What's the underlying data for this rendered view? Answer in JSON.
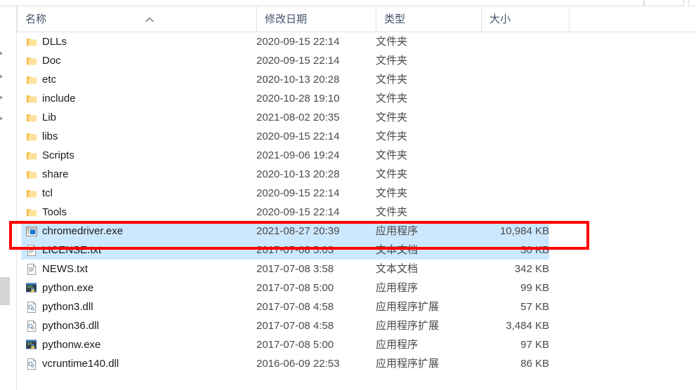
{
  "window": {
    "title": "File Explorer list view",
    "selection_color": "#cce8ff",
    "annotation_color": "#ff0000"
  },
  "columns": {
    "name": "名称",
    "date_modified": "修改日期",
    "type": "类型",
    "size": "大小",
    "sort_indicator": "ascending-caret"
  },
  "rows": [
    {
      "icon": "folder-icon",
      "name": "DLLs",
      "date": "2020-09-15 22:14",
      "type": "文件夹",
      "size": "",
      "selected": false
    },
    {
      "icon": "folder-icon",
      "name": "Doc",
      "date": "2020-09-15 22:14",
      "type": "文件夹",
      "size": "",
      "selected": false
    },
    {
      "icon": "folder-icon",
      "name": "etc",
      "date": "2020-10-13 20:28",
      "type": "文件夹",
      "size": "",
      "selected": false
    },
    {
      "icon": "folder-icon",
      "name": "include",
      "date": "2020-10-28 19:10",
      "type": "文件夹",
      "size": "",
      "selected": false
    },
    {
      "icon": "folder-icon",
      "name": "Lib",
      "date": "2021-08-02 20:35",
      "type": "文件夹",
      "size": "",
      "selected": false
    },
    {
      "icon": "folder-icon",
      "name": "libs",
      "date": "2020-09-15 22:14",
      "type": "文件夹",
      "size": "",
      "selected": false
    },
    {
      "icon": "folder-icon",
      "name": "Scripts",
      "date": "2021-09-06 19:24",
      "type": "文件夹",
      "size": "",
      "selected": false
    },
    {
      "icon": "folder-icon",
      "name": "share",
      "date": "2020-10-13 20:28",
      "type": "文件夹",
      "size": "",
      "selected": false
    },
    {
      "icon": "folder-icon",
      "name": "tcl",
      "date": "2020-09-15 22:14",
      "type": "文件夹",
      "size": "",
      "selected": false
    },
    {
      "icon": "folder-icon",
      "name": "Tools",
      "date": "2020-09-15 22:14",
      "type": "文件夹",
      "size": "",
      "selected": false
    },
    {
      "icon": "application-icon",
      "name": "chromedriver.exe",
      "date": "2021-08-27 20:39",
      "type": "应用程序",
      "size": "10,984 KB",
      "selected": true
    },
    {
      "icon": "text-file-icon",
      "name": "LICENSE.txt",
      "date": "2017-07-08 5:03",
      "type": "文本文档",
      "size": "30 KB",
      "selected": true
    },
    {
      "icon": "text-file-icon",
      "name": "NEWS.txt",
      "date": "2017-07-08 3:58",
      "type": "文本文档",
      "size": "342 KB",
      "selected": false
    },
    {
      "icon": "python-exe-icon",
      "name": "python.exe",
      "date": "2017-07-08 5:00",
      "type": "应用程序",
      "size": "99 KB",
      "selected": false
    },
    {
      "icon": "dll-icon",
      "name": "python3.dll",
      "date": "2017-07-08 4:58",
      "type": "应用程序扩展",
      "size": "57 KB",
      "selected": false
    },
    {
      "icon": "dll-icon",
      "name": "python36.dll",
      "date": "2017-07-08 4:58",
      "type": "应用程序扩展",
      "size": "3,484 KB",
      "selected": false
    },
    {
      "icon": "python-exe-icon",
      "name": "pythonw.exe",
      "date": "2017-07-08 5:00",
      "type": "应用程序",
      "size": "97 KB",
      "selected": false
    },
    {
      "icon": "dll-icon",
      "name": "vcruntime140.dll",
      "date": "2016-06-09 22:53",
      "type": "应用程序扩展",
      "size": "86 KB",
      "selected": false
    }
  ],
  "annotation": {
    "target_row_name": "chromedriver.exe",
    "shape": "rectangle"
  },
  "nav_rail": {
    "arrow_icon": "chevron-collapsed-icon",
    "arrow_count": 4
  }
}
